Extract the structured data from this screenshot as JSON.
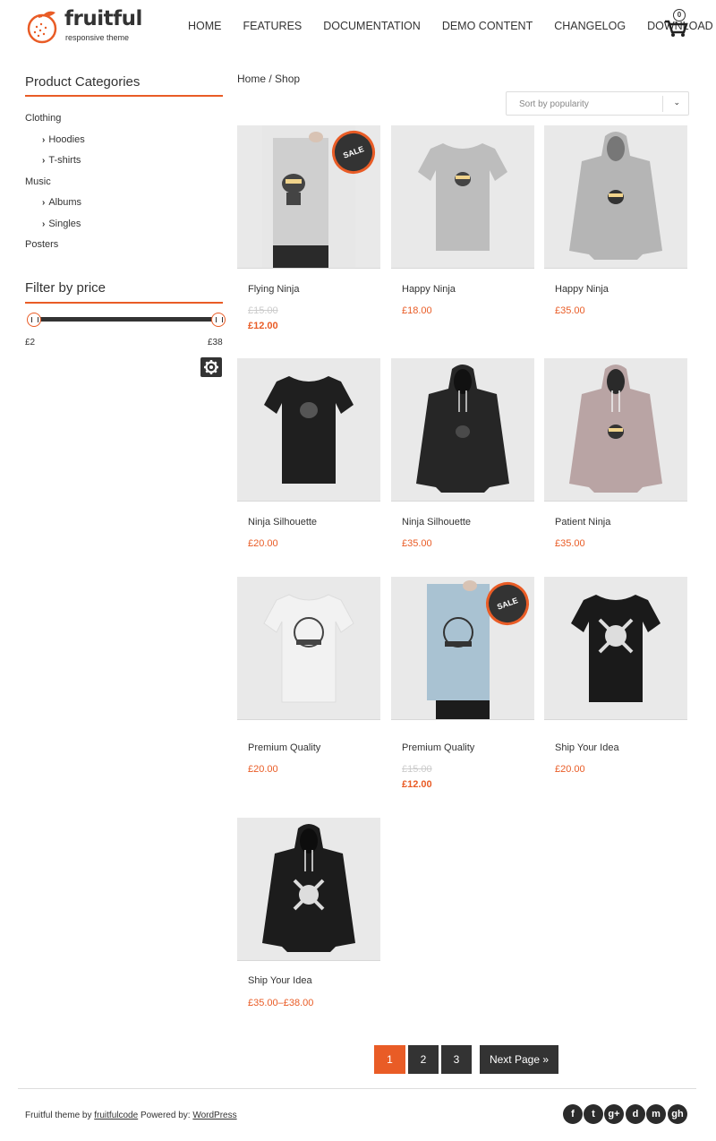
{
  "brand": {
    "name": "fruitful",
    "tagline": "responsive theme"
  },
  "nav": [
    "HOME",
    "FEATURES",
    "DOCUMENTATION",
    "DEMO CONTENT",
    "CHANGELOG",
    "DOWNLOAD"
  ],
  "cart": {
    "count": "0",
    "icon": "cart-icon"
  },
  "sidebar": {
    "categories_title": "Product Categories",
    "categories": {
      "clothing": "Clothing",
      "hoodies": "Hoodies",
      "tshirts": "T-shirts",
      "music": "Music",
      "albums": "Albums",
      "singles": "Singles",
      "posters": "Posters"
    },
    "filter_title": "Filter by price",
    "price_min": "£2",
    "price_max": "£38",
    "filter_icon": "gear-icon"
  },
  "breadcrumb": "Home / Shop",
  "sort": {
    "value": "Sort by popularity"
  },
  "sale_label": "SALE",
  "products": [
    {
      "name": "Flying Ninja",
      "old_price": "£15.00",
      "price": "£12.00"
    },
    {
      "name": "Happy Ninja",
      "price": "£18.00"
    },
    {
      "name": "Happy Ninja",
      "price": "£35.00"
    },
    {
      "name": "Ninja Silhouette",
      "price": "£20.00"
    },
    {
      "name": "Ninja Silhouette",
      "price": "£35.00"
    },
    {
      "name": "Patient Ninja",
      "price": "£35.00"
    },
    {
      "name": "Premium Quality",
      "price": "£20.00"
    },
    {
      "name": "Premium Quality",
      "old_price": "£15.00",
      "price": "£12.00"
    },
    {
      "name": "Ship Your Idea",
      "price": "£20.00"
    },
    {
      "name": "Ship Your Idea",
      "price": "£35.00–£38.00"
    }
  ],
  "pagination": {
    "pages": [
      "1",
      "2",
      "3"
    ],
    "next": "Next Page »"
  },
  "footer": {
    "prefix": "Fruitful theme by ",
    "author": "fruitfulcode",
    "middle": " Powered by: ",
    "platform": "WordPress",
    "social": [
      "f",
      "t",
      "g+",
      "d",
      "m",
      "gh"
    ]
  },
  "colors": {
    "accent": "#e95c26",
    "dark": "#333333"
  }
}
